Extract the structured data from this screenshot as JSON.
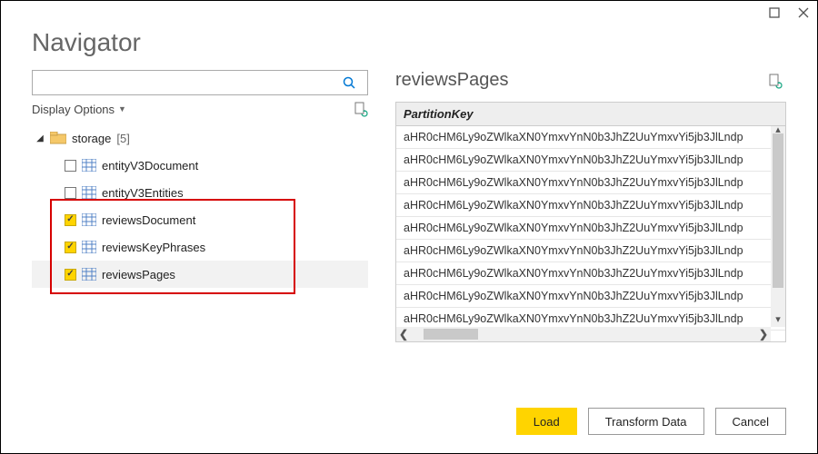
{
  "window": {
    "title": "Navigator"
  },
  "toolbar": {
    "display_options": "Display Options"
  },
  "tree": {
    "root": {
      "name": "storage",
      "count_suffix": "[5]"
    },
    "items": [
      {
        "label": "entityV3Document",
        "checked": false
      },
      {
        "label": "entityV3Entities",
        "checked": false
      },
      {
        "label": "reviewsDocument",
        "checked": true
      },
      {
        "label": "reviewsKeyPhrases",
        "checked": true
      },
      {
        "label": "reviewsPages",
        "checked": true
      }
    ]
  },
  "preview": {
    "title": "reviewsPages",
    "column": "PartitionKey",
    "rows": [
      "aHR0cHM6Ly9oZWlkaXN0YmxvYnN0b3JhZ2UuYmxvYi5jb3JlLndp",
      "aHR0cHM6Ly9oZWlkaXN0YmxvYnN0b3JhZ2UuYmxvYi5jb3JlLndp",
      "aHR0cHM6Ly9oZWlkaXN0YmxvYnN0b3JhZ2UuYmxvYi5jb3JlLndp",
      "aHR0cHM6Ly9oZWlkaXN0YmxvYnN0b3JhZ2UuYmxvYi5jb3JlLndp",
      "aHR0cHM6Ly9oZWlkaXN0YmxvYnN0b3JhZ2UuYmxvYi5jb3JlLndp",
      "aHR0cHM6Ly9oZWlkaXN0YmxvYnN0b3JhZ2UuYmxvYi5jb3JlLndp",
      "aHR0cHM6Ly9oZWlkaXN0YmxvYnN0b3JhZ2UuYmxvYi5jb3JlLndp",
      "aHR0cHM6Ly9oZWlkaXN0YmxvYnN0b3JhZ2UuYmxvYi5jb3JlLndp",
      "aHR0cHM6Ly9oZWlkaXN0YmxvYnN0b3JhZ2UuYmxvYi5jb3JlLndp"
    ]
  },
  "footer": {
    "load": "Load",
    "transform": "Transform Data",
    "cancel": "Cancel"
  }
}
